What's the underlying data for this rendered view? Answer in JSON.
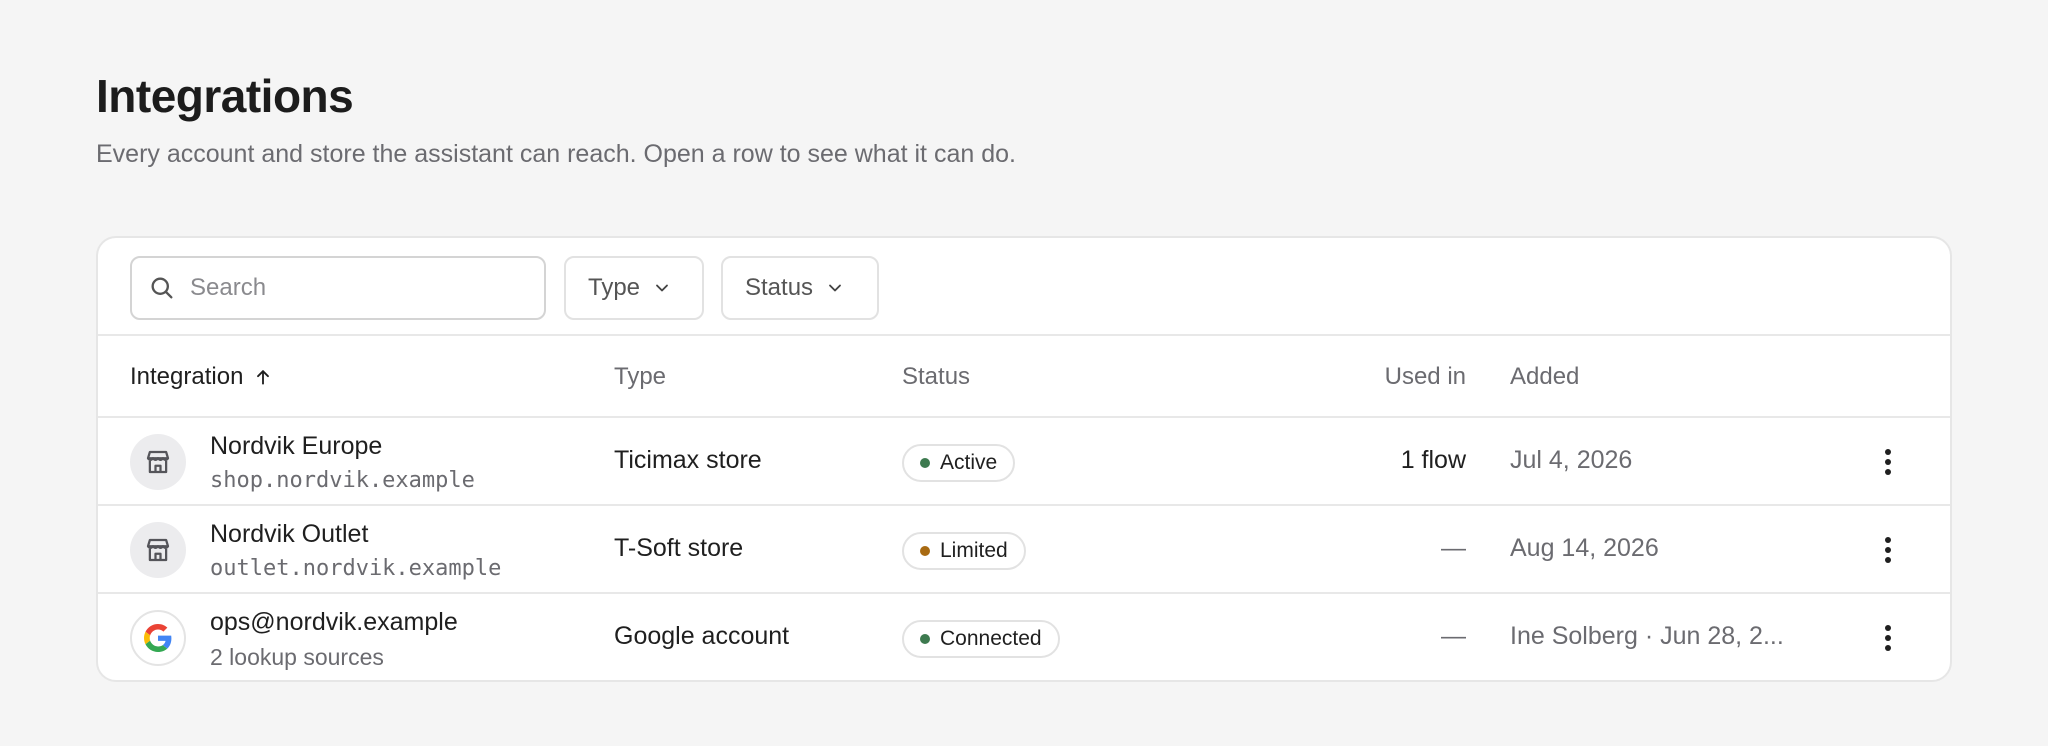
{
  "page": {
    "title": "Integrations",
    "subtitle": "Every account and store the assistant can reach. Open a row to see what it can do."
  },
  "toolbar": {
    "search_placeholder": "Search",
    "filter_type_label": "Type",
    "filter_status_label": "Status"
  },
  "table": {
    "headers": {
      "integration": "Integration",
      "type": "Type",
      "status": "Status",
      "used_in": "Used in",
      "added": "Added"
    },
    "sort": {
      "column": "integration",
      "direction": "ascending"
    },
    "rows": [
      {
        "icon": "store-icon",
        "name": "Nordvik Europe",
        "sub": "shop.nordvik.example",
        "type": "Ticimax store",
        "status": "Active",
        "status_color": "#3d7a4f",
        "used_in": "1 flow",
        "added": "Jul 4, 2026"
      },
      {
        "icon": "store-icon",
        "name": "Nordvik Outlet",
        "sub": "outlet.nordvik.example",
        "type": "T-Soft store",
        "status": "Limited",
        "status_color": "#a86a12",
        "used_in": "—",
        "added": "Aug 14, 2026"
      },
      {
        "icon": "google-icon",
        "name": "ops@nordvik.example",
        "sub": "2 lookup sources",
        "type": "Google account",
        "status": "Connected",
        "status_color": "#3d7a4f",
        "used_in": "—",
        "added": "Ine Solberg · Jun 28, 2..."
      }
    ]
  },
  "colors": {
    "background": "#f5f5f5",
    "card": "#ffffff",
    "border": "#e6e6e6",
    "muted_text": "#6b6b70"
  }
}
